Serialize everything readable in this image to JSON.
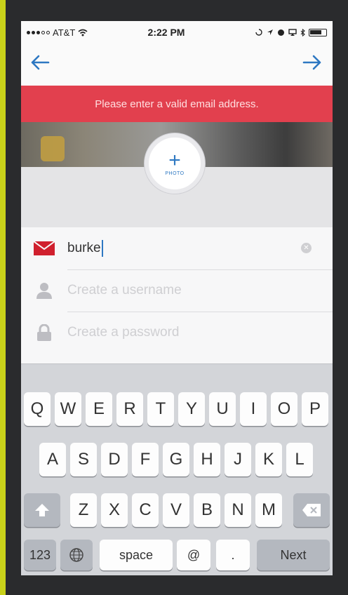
{
  "status_bar": {
    "carrier": "AT&T",
    "time": "2:22 PM"
  },
  "nav": {
    "back_icon": "arrow-left-icon",
    "next_icon": "arrow-right-icon",
    "accent_color": "#2e78c2"
  },
  "error_banner": {
    "message": "Please enter a valid email address.",
    "color": "#e2404e"
  },
  "photo_button": {
    "plus": "+",
    "label": "PHOTO"
  },
  "form": {
    "email": {
      "value": "burke",
      "icon": "mail-icon",
      "icon_color": "#d0202e"
    },
    "username": {
      "placeholder": "Create a username",
      "icon": "user-icon"
    },
    "password": {
      "placeholder": "Create a password",
      "icon": "lock-icon"
    }
  },
  "keyboard": {
    "row1": [
      "Q",
      "W",
      "E",
      "R",
      "T",
      "Y",
      "U",
      "I",
      "O",
      "P"
    ],
    "row2": [
      "A",
      "S",
      "D",
      "F",
      "G",
      "H",
      "J",
      "K",
      "L"
    ],
    "row3": [
      "Z",
      "X",
      "C",
      "V",
      "B",
      "N",
      "M"
    ],
    "numbers_label": "123",
    "space_label": "space",
    "at_label": "@",
    "dot_label": ".",
    "next_label": "Next"
  }
}
